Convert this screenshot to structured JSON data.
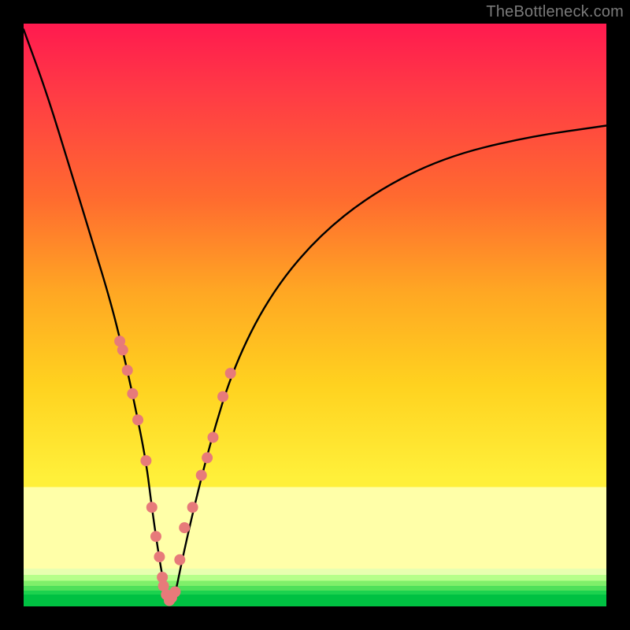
{
  "watermark": "TheBottleneck.com",
  "chart_data": {
    "type": "line",
    "title": "",
    "xlabel": "",
    "ylabel": "",
    "xlim": [
      0,
      100
    ],
    "ylim": [
      0,
      100
    ],
    "grid": false,
    "legend": false,
    "series": [
      {
        "name": "curve",
        "color": "#000000",
        "x": [
          0,
          4,
          8,
          12,
          15,
          17,
          19,
          21,
          22,
          23,
          24,
          25,
          26,
          27,
          29,
          32,
          36,
          42,
          50,
          60,
          72,
          86,
          100
        ],
        "values": [
          99,
          88,
          75,
          62,
          52,
          44,
          35,
          25,
          17,
          10,
          4,
          1,
          2,
          7,
          16,
          28,
          41,
          53,
          63,
          71,
          77,
          80.5,
          82.5
        ]
      }
    ],
    "markers": {
      "name": "highlight-dots",
      "color": "#e77a7a",
      "radius_px": 7,
      "x": [
        16.5,
        17.0,
        17.8,
        18.7,
        19.6,
        21.0,
        22.0,
        22.7,
        23.3,
        23.8,
        24.0,
        24.5,
        25.0,
        25.4,
        26.0,
        26.8,
        27.6,
        29.0,
        30.5,
        31.5,
        32.5,
        34.2,
        35.5
      ],
      "values": [
        45.5,
        44.0,
        40.5,
        36.5,
        32.0,
        25.0,
        17.0,
        12.0,
        8.5,
        5.0,
        3.5,
        2.0,
        1.0,
        1.5,
        2.5,
        8.0,
        13.5,
        17.0,
        22.5,
        25.5,
        29.0,
        36.0,
        40.0
      ]
    }
  }
}
